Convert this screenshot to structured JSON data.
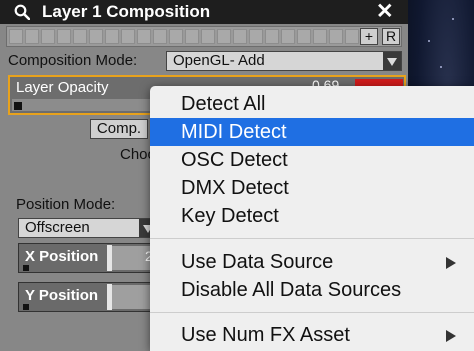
{
  "window": {
    "title": "Layer 1 Composition",
    "close_glyph": "✕"
  },
  "toolbar": {
    "add_label": "+",
    "r_label": "R"
  },
  "composition": {
    "label": "Composition Mode:",
    "value": "OpenGL- Add"
  },
  "opacity": {
    "label": "Layer Opacity",
    "value": "0.69"
  },
  "comp_button": "Comp.",
  "partial_label": "Choo",
  "position_mode": {
    "label": "Position Mode:",
    "value": "Offscreen"
  },
  "x_position": {
    "label": "X Position",
    "value": "2"
  },
  "y_position": {
    "label": "Y Position"
  },
  "context_menu": {
    "items": [
      {
        "label": "Detect All"
      },
      {
        "label": "MIDI Detect"
      },
      {
        "label": "OSC Detect"
      },
      {
        "label": "DMX Detect"
      },
      {
        "label": "Key Detect"
      }
    ],
    "data_source": {
      "use": "Use Data Source",
      "disable_all": "Disable All Data Sources"
    },
    "fx_asset": "Use Num FX Asset",
    "selected_index": 1
  },
  "colors": {
    "accent": "#1f6fe3",
    "opacity_border": "#e8a21c",
    "alert": "#d21b1b"
  }
}
